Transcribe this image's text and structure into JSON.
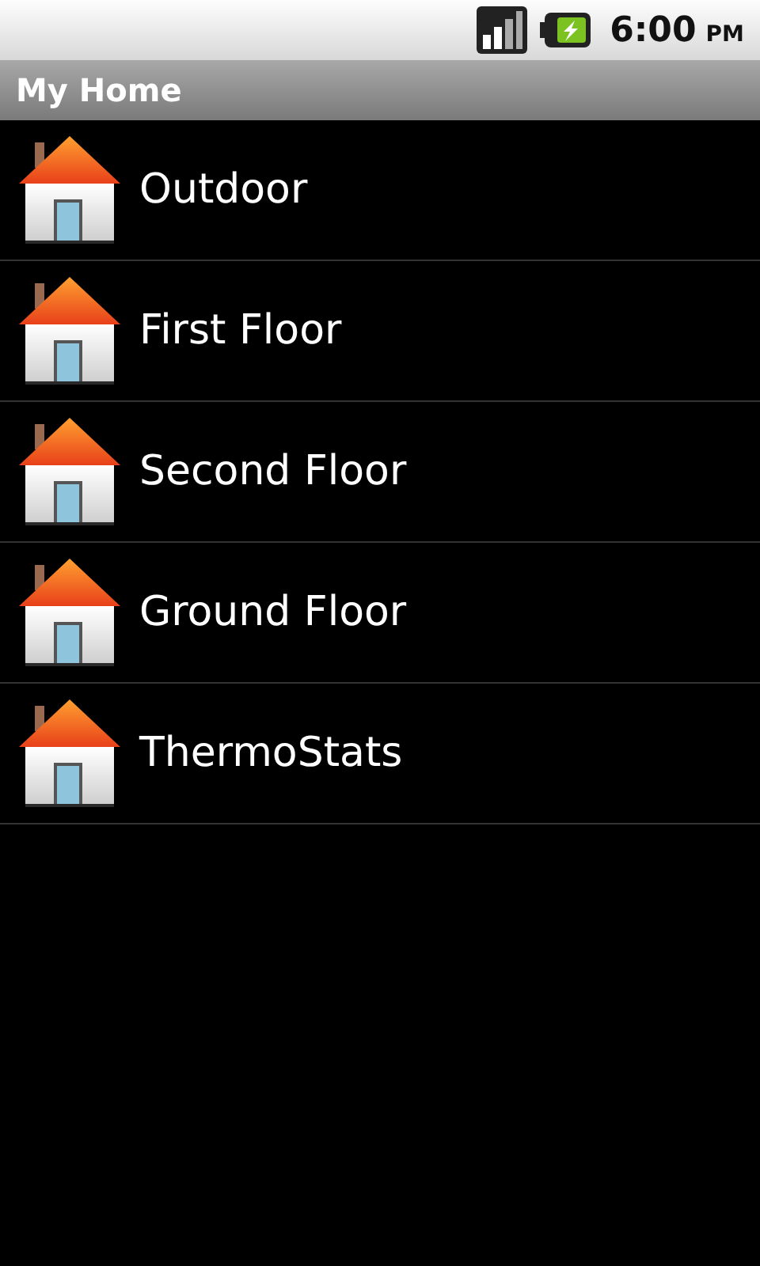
{
  "status_bar": {
    "time": "6:00",
    "period": "PM"
  },
  "title_bar": {
    "title": "My Home"
  },
  "items": [
    {
      "label": "Outdoor"
    },
    {
      "label": "First Floor"
    },
    {
      "label": "Second Floor"
    },
    {
      "label": "Ground Floor"
    },
    {
      "label": "ThermoStats"
    }
  ]
}
